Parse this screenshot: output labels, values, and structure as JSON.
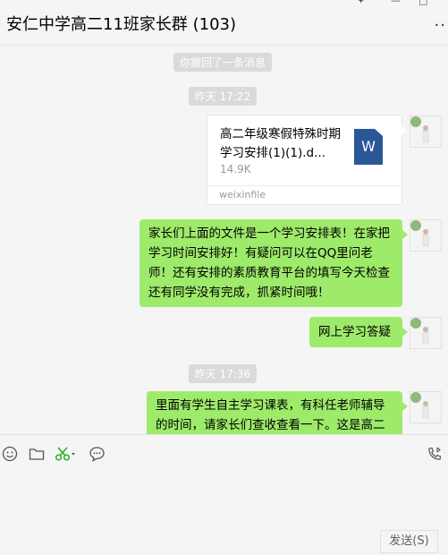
{
  "window": {
    "title": "安仁中学高二11班家长群 (103)"
  },
  "messages": {
    "recall_notice": "你撤回了一条消息",
    "time1": "昨天 17:22",
    "file": {
      "name": "高二年级寒假特殊时期学习安排(1)(1).d...",
      "size": "14.9K",
      "source": "weixinfile",
      "type_icon": "W"
    },
    "msg1": "家长们上面的文件是一个学习安排表！在家把学习时间安排好！有疑问可以在QQ里问老师！还有安排的素质教育平台的填写今天检查还有同学没有完成，抓紧时间哦！",
    "msg2": "网上学习答疑",
    "time2": "昨天 17:36",
    "msg3": "里面有学生自主学习课表，有科任老师辅导的时间，请家长们查收查看一下。这是高二"
  },
  "input": {
    "send_label": "发送(S)"
  },
  "colors": {
    "bubble": "#9eea6a",
    "background": "#f5f5f5",
    "file_icon": "#2b5797",
    "scissors": "#1aad19"
  }
}
